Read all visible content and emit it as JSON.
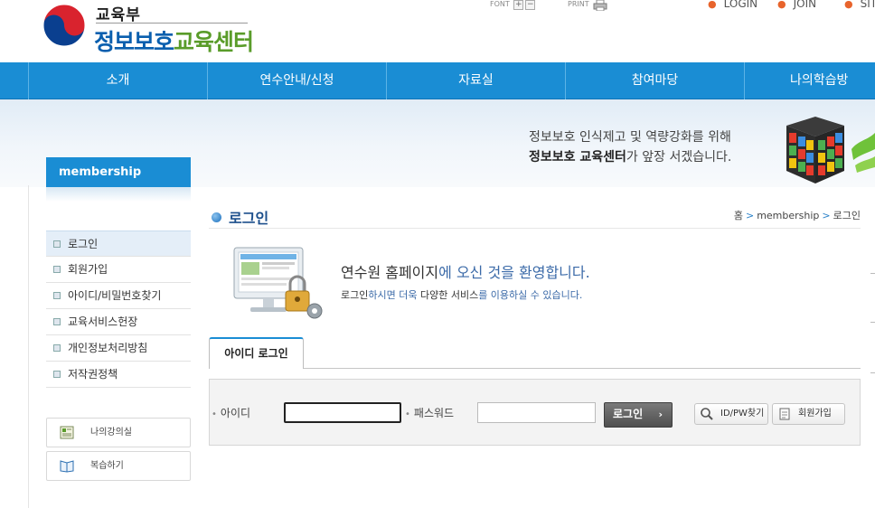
{
  "header": {
    "logo_small": "교육부",
    "logo_big_blue": "정보보호",
    "logo_big_green": "교육센터",
    "util_font": "FONT",
    "util_plus": "+",
    "util_minus": "−",
    "util_print": "PRINT",
    "links": [
      "LOGIN",
      "JOIN",
      "SITE"
    ]
  },
  "gnb": [
    "소개",
    "연수안내/신청",
    "자료실",
    "참여마당",
    "나의학습방"
  ],
  "banner": {
    "line1": "정보보호 인식제고 및 역량강화를 위해",
    "line2_bold": "정보보호 교육센터",
    "line2_rest": "가 앞장 서겠습니다."
  },
  "sidebar": {
    "tab": "membership",
    "items": [
      "로그인",
      "회원가입",
      "아이디/비밀번호찾기",
      "교육서비스헌장",
      "개인정보처리방침",
      "저작권정책"
    ],
    "quick": [
      "나의강의실",
      "복습하기"
    ]
  },
  "content": {
    "title": "로그인",
    "breadcrumb": [
      "홈",
      "membership",
      "로그인"
    ],
    "welcome1_a": "연수원 홈페이지",
    "welcome1_b": "에 오신 것을 환영합니다.",
    "welcome2_a": "로그인",
    "welcome2_b": "하시면 더욱 ",
    "welcome2_c": "다양한 서비스",
    "welcome2_d": "를 이용하실 수 있습니다.",
    "tab": "아이디 로그인",
    "form": {
      "id_label": "아이디",
      "id_value": "",
      "pw_label": "패스워드",
      "pw_value": "",
      "login_btn": "로그인",
      "find_btn": "ID/PW찾기",
      "join_btn": "회원가입"
    }
  },
  "colors": {
    "accent": "#1a8dd4",
    "brand_blue": "#0a5fae",
    "brand_green": "#5a9c2a",
    "link_orange": "#e8642c"
  }
}
